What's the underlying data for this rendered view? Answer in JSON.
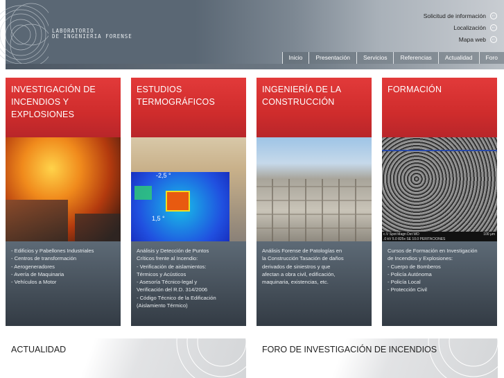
{
  "header": {
    "logo_line1": "LABORATORIO",
    "logo_line2": "DE INGENIERIA FORENSE",
    "top_links": [
      "Solicitud de información",
      "Localización",
      "Mapa web"
    ],
    "nav": [
      "Inicio",
      "Presentación",
      "Servicios",
      "Referencias",
      "Actualidad",
      "Foro"
    ]
  },
  "columns": [
    {
      "title": "INVESTIGACIÓN DE INCENDIOS Y EXPLOSIONES",
      "lines": [
        "- Edificios y Pabellones Industriales",
        "- Centros de transformación",
        "- Aerogeneradores",
        "- Avería de Maquinaria",
        "- Vehículos a Motor"
      ]
    },
    {
      "title": "ESTUDIOS TERMOGRÁFICOS",
      "overlay": [
        "-2,5 °",
        "1,5 °"
      ],
      "lines": [
        "Análisis y Detección de Puntos",
        "Críticos frente al Incendio:",
        "- Verificación de aislamientos:",
        "Térmicos y Acústicos",
        "- Asesoría Técnico-legal y",
        "Verificación del R.D. 314/2006",
        "- Código Técnico de la Edificación",
        "(Aislamiento Térmico)"
      ]
    },
    {
      "title": "INGENIERÍA DE LA CONSTRUCCIÓN",
      "lines": [
        "Análisis Forense de Patologías en",
        "la Construcción Tasación de daños",
        "derivados de siniestros y que",
        "afectan a obra civil, edificación,",
        "maquinaria, existencias, etc."
      ]
    },
    {
      "title": "FORMACIÓN",
      "overlay": [
        "c.V   Spot Magn    Det  WD",
        ".0 kV 5.0   825x    SE   10.0 PERITACIONES",
        "100 µm"
      ],
      "lines": [
        "Cursos de Formación en Investigación",
        "de Incendios y Explosiones:",
        "- Cuerpo de Bomberos",
        "- Policía Autónoma",
        "- Policía Local",
        "- Protección Civil"
      ]
    }
  ],
  "sections": [
    "ACTUALIDAD",
    "FORO DE INVESTIGACIÓN DE INCENDIOS"
  ]
}
